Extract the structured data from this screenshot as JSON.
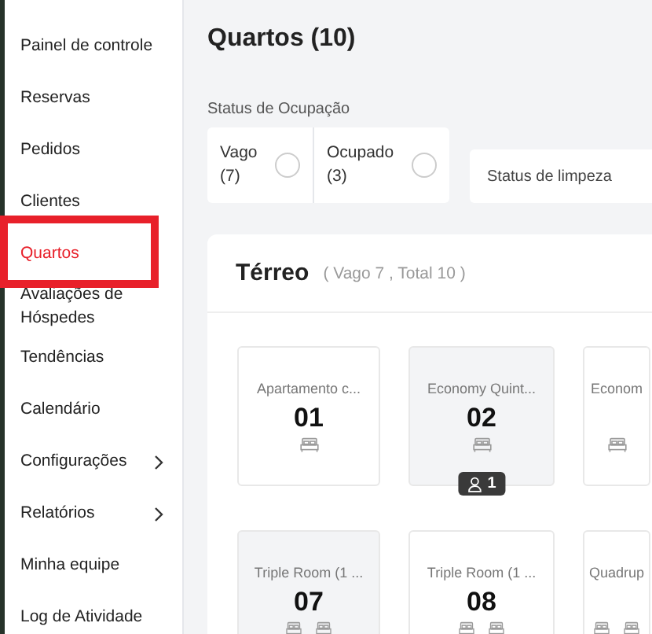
{
  "sidebar": {
    "items": [
      {
        "label": "Painel de controle",
        "selected": false,
        "highlighted": false
      },
      {
        "label": "Reservas",
        "selected": false,
        "highlighted": false
      },
      {
        "label": "Pedidos",
        "selected": false,
        "highlighted": false
      },
      {
        "label": "Clientes",
        "selected": false,
        "highlighted": false
      },
      {
        "label": "Quartos",
        "selected": true,
        "highlighted": true
      },
      {
        "label": "Avaliações de Hóspedes",
        "selected": false,
        "highlighted": false
      },
      {
        "label": "Tendências",
        "selected": false,
        "highlighted": false
      },
      {
        "label": "Calendário",
        "selected": false,
        "highlighted": false
      },
      {
        "label": "Configurações",
        "selected": false,
        "highlighted": false,
        "expandable": true
      },
      {
        "label": "Relatórios",
        "selected": false,
        "highlighted": false,
        "expandable": true
      },
      {
        "label": "Minha equipe",
        "selected": false,
        "highlighted": false
      },
      {
        "label": "Log de Atividade",
        "selected": false,
        "highlighted": false
      }
    ]
  },
  "page": {
    "title": "Quartos (10)"
  },
  "filters": {
    "occupancy_label": "Status de Ocupação",
    "occupancy_options": [
      {
        "label": "Vago (7)",
        "checked": false
      },
      {
        "label": "Ocupado (3)",
        "checked": false
      }
    ],
    "cleaning": {
      "placeholder": "Status de limpeza"
    }
  },
  "floor": {
    "title": "Térreo",
    "summary": "( Vago 7 , Total 10 )",
    "rooms": [
      {
        "name": "Apartamento c...",
        "number": "01",
        "occupied": false,
        "kind": "double"
      },
      {
        "name": "Economy Quint...",
        "number": "02",
        "occupied": true,
        "kind": "double",
        "guests": "1"
      },
      {
        "name": "Econom",
        "occupied": false,
        "kind": "double"
      },
      {
        "name": "Triple Room (1 ...",
        "number": "07",
        "occupied": true,
        "kind": "twin"
      },
      {
        "name": "Triple Room (1 ...",
        "number": "08",
        "occupied": false,
        "kind": "twin"
      },
      {
        "name": "Quadrup",
        "occupied": false,
        "kind": "twin"
      }
    ]
  }
}
